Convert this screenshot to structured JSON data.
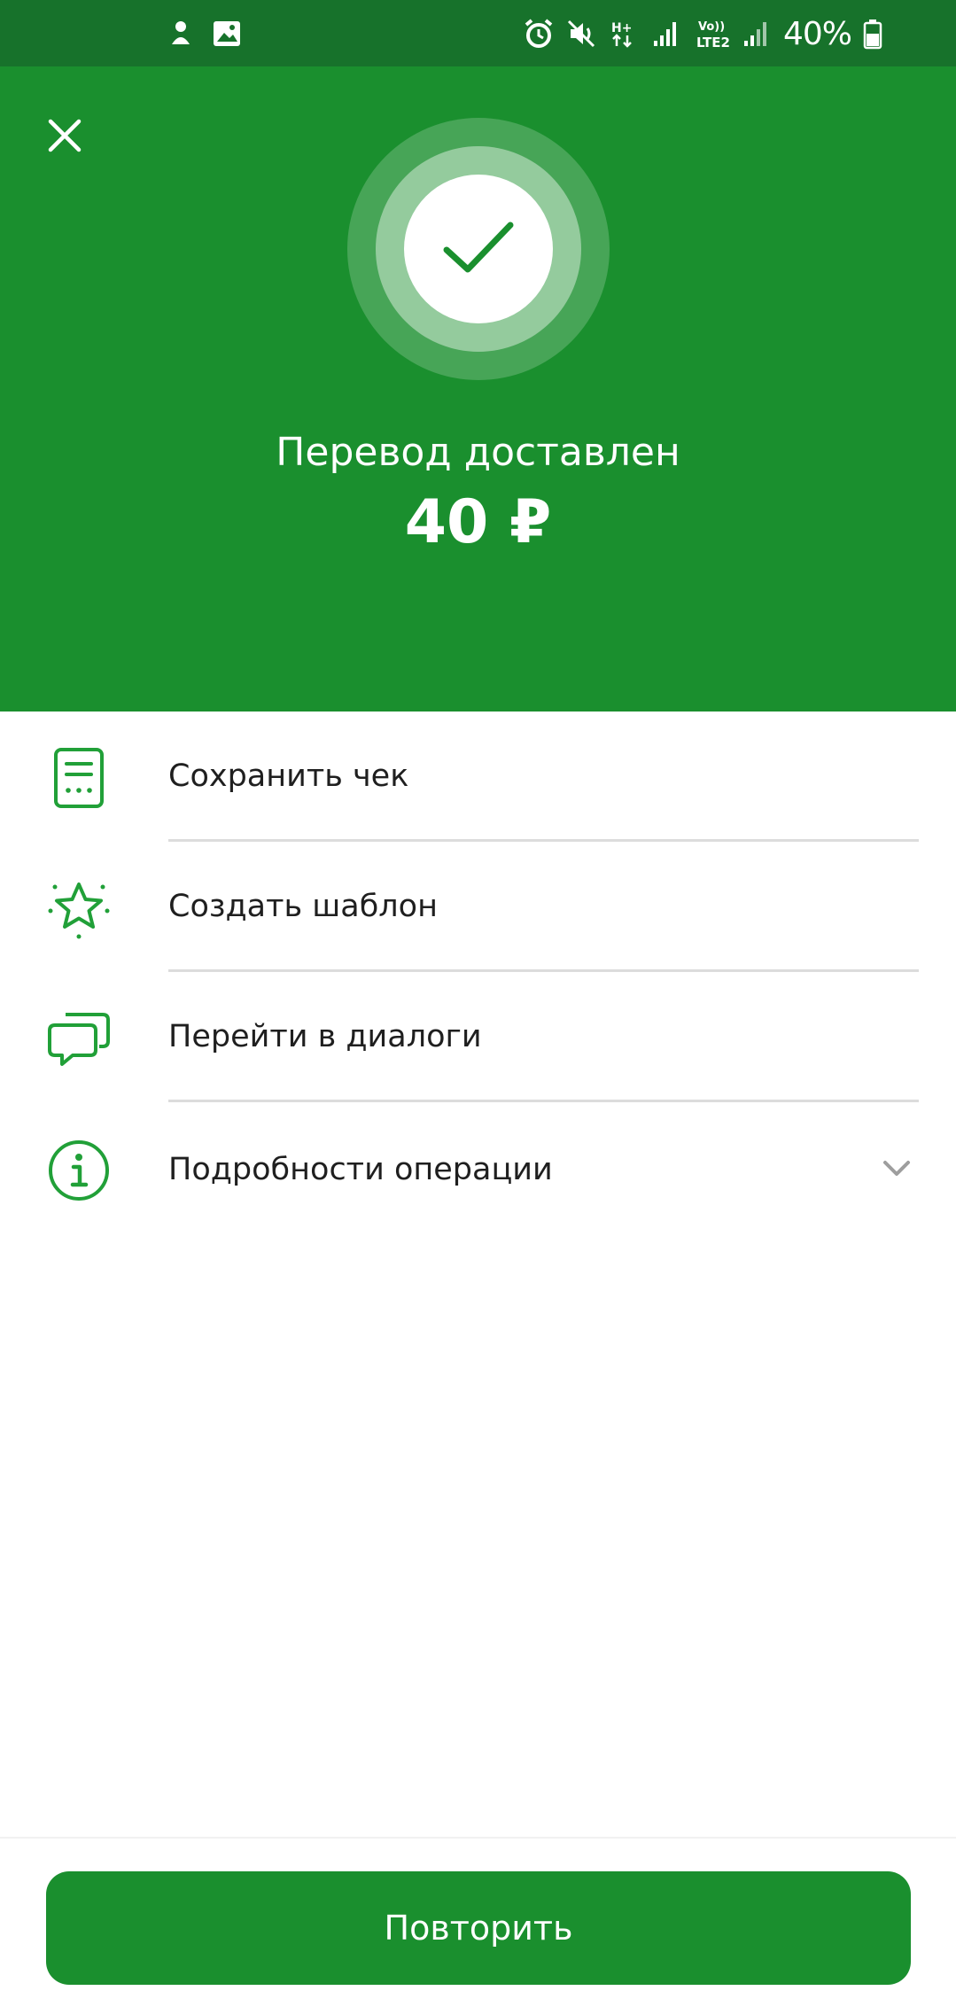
{
  "status_bar": {
    "battery_percent": "40%",
    "network_label": "LTE2",
    "icons": [
      "android-notification-icon",
      "image-icon",
      "alarm-icon",
      "mute-icon",
      "hplus-data-icon",
      "signal-icon",
      "volte-icon",
      "signal-icon-2",
      "battery-icon"
    ]
  },
  "header": {
    "close_icon": "close-icon",
    "success_icon": "checkmark-icon",
    "title": "Перевод доставлен",
    "amount": "40 ₽",
    "background_color": "#1a8f2e"
  },
  "actions": [
    {
      "label": "Сохранить чек",
      "icon": "receipt-icon"
    },
    {
      "label": "Создать шаблон",
      "icon": "star-icon"
    },
    {
      "label": "Перейти в диалоги",
      "icon": "chat-bubbles-icon"
    },
    {
      "label": "Подробности операции",
      "icon": "info-icon",
      "trailing_icon": "chevron-down-icon"
    }
  ],
  "footer": {
    "repeat_label": "Повторить"
  },
  "colors": {
    "accent": "#1a8f2e",
    "status_bar": "#17722b",
    "icon_green": "#21a038"
  }
}
